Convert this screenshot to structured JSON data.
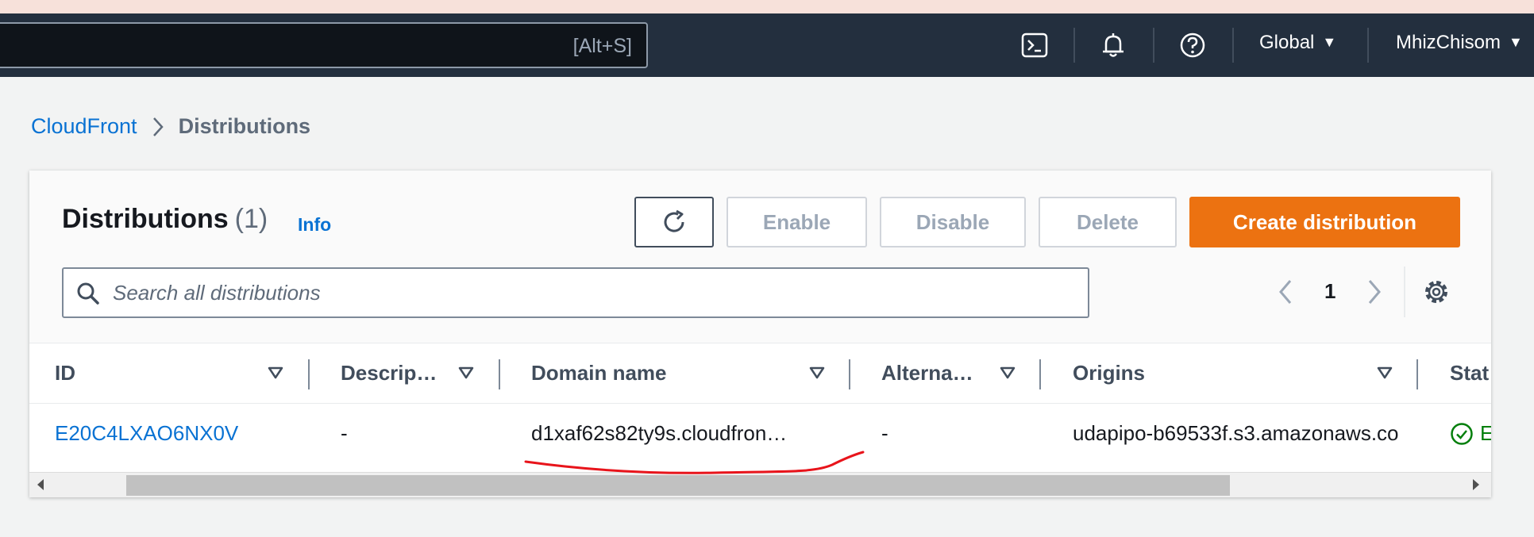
{
  "topbar": {
    "search_shortcut": "[Alt+S]",
    "region": "Global",
    "user": "MhizChisom",
    "icons": [
      "cloudshell-icon",
      "bell-icon",
      "help-icon"
    ]
  },
  "breadcrumb": {
    "parent": "CloudFront",
    "current": "Distributions"
  },
  "panel": {
    "title": "Distributions",
    "count": "(1)",
    "info": "Info",
    "buttons": {
      "enable": "Enable",
      "disable": "Disable",
      "delete": "Delete",
      "create": "Create distribution"
    },
    "search_placeholder": "Search all distributions",
    "page": "1"
  },
  "table": {
    "columns": [
      "ID",
      "Descrip…",
      "Domain name",
      "Alterna…",
      "Origins",
      "Stat"
    ],
    "rows": [
      {
        "id": "E20C4LXAO6NX0V",
        "description": "-",
        "domain": "d1xaf62s82ty9s.cloudfron…",
        "alternate": "-",
        "origins": "udapipo-b69533f.s3.amazonaws.co",
        "status": "E"
      }
    ]
  },
  "colors": {
    "topbar": "#232f3e",
    "link": "#0972d3",
    "primary": "#ec7211",
    "success": "#037f0c",
    "annotation": "#e8141b"
  }
}
